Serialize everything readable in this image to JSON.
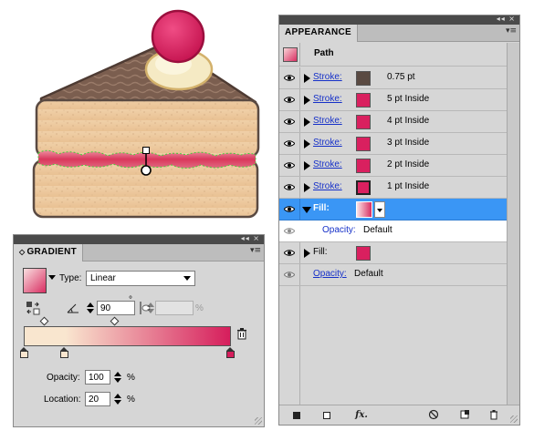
{
  "colors": {
    "cake_pink": "#d9205f",
    "stroke_brown": "#5a4a42",
    "selection_blue": "#3a96f5",
    "gradient_start": "#f9e6cf",
    "gradient_end": "#d61e5c"
  },
  "appearance": {
    "tab": "APPEARANCE",
    "topbar_glyphs": "◂◂ ×",
    "menu_glyph": "▾≡",
    "path_label": "Path",
    "rows": [
      {
        "label": "Stroke:",
        "value": "0.75 pt",
        "swatch": "#5a4a42",
        "icon": "eye-icon"
      },
      {
        "label": "Stroke:",
        "value": "5 pt  Inside",
        "swatch": "#d9205f",
        "icon": "eye-icon"
      },
      {
        "label": "Stroke:",
        "value": "4 pt  Inside",
        "swatch": "#d9205f",
        "icon": "eye-icon"
      },
      {
        "label": "Stroke:",
        "value": "3 pt  Inside",
        "swatch": "#d9205f",
        "icon": "eye-icon"
      },
      {
        "label": "Stroke:",
        "value": "2 pt  Inside",
        "swatch": "#d9205f",
        "icon": "eye-icon"
      },
      {
        "label": "Stroke:",
        "value": "1 pt  Inside",
        "swatch": "#d9205f",
        "icon": "eye-icon"
      }
    ],
    "fill_selected": {
      "label": "Fill:"
    },
    "opacity_sub": {
      "label": "Opacity:",
      "value": "Default"
    },
    "fill_row": {
      "label": "Fill:",
      "swatch": "#d9205f"
    },
    "opacity_row": {
      "label": "Opacity:",
      "value": "Default"
    },
    "bottom_icons": [
      "square-icon",
      "empty-square-icon",
      "fx-icon",
      "no-icon",
      "new-item-icon",
      "trash-icon"
    ],
    "fx_label": "fx."
  },
  "gradient": {
    "tab": "GRADIENT",
    "tab_prefix": "◇",
    "topbar_glyphs": "◂◂ ×",
    "menu_glyph": "▾≡",
    "type_label": "Type:",
    "type_value": "Linear",
    "angle_value": "90",
    "degree_symbol": "°",
    "aspect_suffix": "%",
    "opacity_label": "Opacity:",
    "opacity_value": "100",
    "opacity_unit": "%",
    "location_label": "Location:",
    "location_value": "20",
    "location_unit": "%"
  }
}
